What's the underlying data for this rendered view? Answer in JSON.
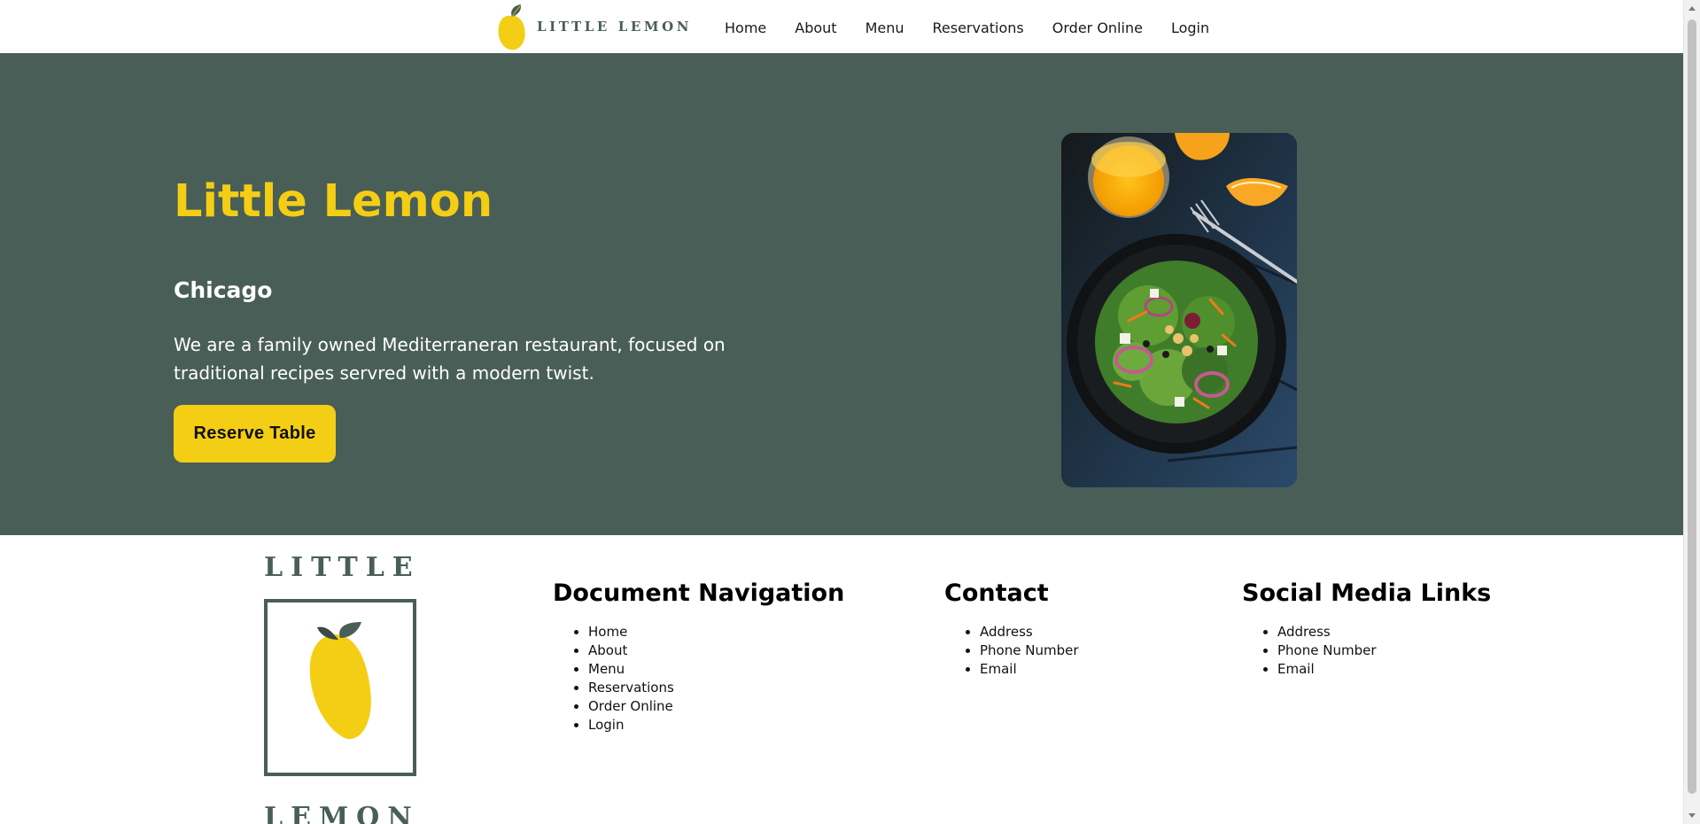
{
  "header": {
    "brand_text": "LITTLE LEMON",
    "nav": [
      "Home",
      "About",
      "Menu",
      "Reservations",
      "Order Online",
      "Login"
    ]
  },
  "hero": {
    "title": "Little Lemon",
    "subtitle": "Chicago",
    "description": "We are a family owned Mediterraneran restaurant, focused on traditional recipes servred with a modern twist.",
    "button_label": "Reserve Table",
    "photo": "salad-bowl-with-orange-juice"
  },
  "footer": {
    "logo_top_word": "LITTLE",
    "logo_bottom_word": "LEMON",
    "nav_heading": "Document Navigation",
    "nav_items": [
      "Home",
      "About",
      "Menu",
      "Reservations",
      "Order Online",
      "Login"
    ],
    "contact_heading": "Contact",
    "contact_items": [
      "Address",
      "Phone Number",
      "Email"
    ],
    "social_heading": "Social Media Links",
    "social_items": [
      "Address",
      "Phone Number",
      "Email"
    ]
  },
  "colors": {
    "primary_green": "#495e57",
    "primary_yellow": "#f4ce14",
    "white": "#ffffff"
  }
}
